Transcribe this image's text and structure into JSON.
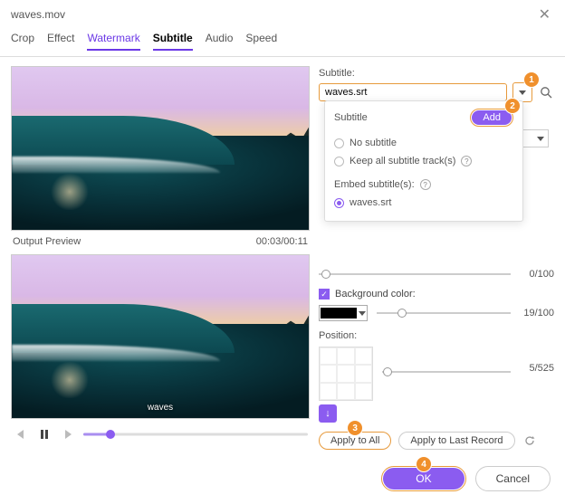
{
  "titlebar": {
    "title": "waves.mov"
  },
  "tabs": {
    "crop": "Crop",
    "effect": "Effect",
    "watermark": "Watermark",
    "subtitle": "Subtitle",
    "audio": "Audio",
    "speed": "Speed"
  },
  "preview": {
    "label": "Output Preview",
    "time": "00:03/00:11",
    "caption": "waves"
  },
  "panel": {
    "subtitle_label": "Subtitle:",
    "subtitle_value": "waves.srt",
    "popup": {
      "heading": "Subtitle",
      "add": "Add",
      "no_subtitle": "No subtitle",
      "keep_all": "Keep all subtitle track(s)",
      "embed": "Embed subtitle(s):",
      "selected": "waves.srt"
    },
    "slider1_value": "0/100",
    "bg_label": "Background color:",
    "bg_slider_value": "19/100",
    "position_label": "Position:",
    "position_value": "5/525",
    "apply_all": "Apply to All",
    "apply_last": "Apply to Last Record"
  },
  "footer": {
    "ok": "OK",
    "cancel": "Cancel"
  },
  "callouts": {
    "c1": "1",
    "c2": "2",
    "c3": "3",
    "c4": "4"
  },
  "icons": {
    "down_arrow": "↓"
  }
}
